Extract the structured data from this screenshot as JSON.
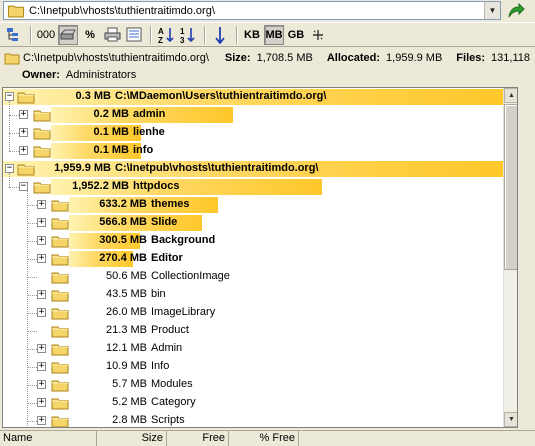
{
  "address": {
    "path": "C:\\Inetpub\\vhosts\\tuthientraitimdo.org\\"
  },
  "toolbar": {
    "kb": "KB",
    "mb": "MB",
    "gb": "GB",
    "dots": "000",
    "percent": "%",
    "sort_az": "A↓Z",
    "sort_num": "1↓3"
  },
  "info": {
    "path": "C:\\Inetpub\\vhosts\\tuthientraitimdo.org\\",
    "size_label": "Size:",
    "size_value": "1,708.5 MB",
    "alloc_label": "Allocated:",
    "alloc_value": "1,959.9 MB",
    "files_label": "Files:",
    "files_value": "131,118",
    "owner_label": "Owner:",
    "owner_value": "Administrators"
  },
  "tree": [
    {
      "size": "0.3 MB",
      "name": "C:\\MDaemon\\Users\\tuthientraitimdo.org\\",
      "bold": true,
      "level": 0,
      "exp": "−",
      "bar_pct": 1.0
    },
    {
      "size": "0.2 MB",
      "name": "admin",
      "bold": true,
      "level": 1,
      "exp": "+",
      "bar_pct": 0.67
    },
    {
      "size": "0.1 MB",
      "name": "lienhe",
      "bold": true,
      "level": 1,
      "exp": "+",
      "bar_pct": 0.33
    },
    {
      "size": "0.1 MB",
      "name": "info",
      "bold": true,
      "level": 1,
      "exp": "+",
      "bar_pct": 0.33
    },
    {
      "size": "1,959.9 MB",
      "name": "C:\\Inetpub\\vhosts\\tuthientraitimdo.org\\",
      "bold": true,
      "level": 0,
      "exp": "−",
      "bar_pct": 1.0
    },
    {
      "size": "1,952.2 MB",
      "name": "httpdocs",
      "bold": true,
      "level": 1,
      "exp": "−",
      "bar_pct": 0.996
    },
    {
      "size": "633.2 MB",
      "name": "themes",
      "bold": true,
      "level": 2,
      "exp": "+",
      "bar_pct": 0.324
    },
    {
      "size": "566.8 MB",
      "name": "Slide",
      "bold": true,
      "level": 2,
      "exp": "+",
      "bar_pct": 0.29
    },
    {
      "size": "300.5 MB",
      "name": "Background",
      "bold": true,
      "level": 2,
      "exp": "+",
      "bar_pct": 0.154
    },
    {
      "size": "270.4 MB",
      "name": "Editor",
      "bold": true,
      "level": 2,
      "exp": "+",
      "bar_pct": 0.139
    },
    {
      "size": "50.6 MB",
      "name": "CollectionImage",
      "bold": false,
      "level": 2,
      "exp": "",
      "bar_pct": 0
    },
    {
      "size": "43.5 MB",
      "name": "bin",
      "bold": false,
      "level": 2,
      "exp": "+",
      "bar_pct": 0
    },
    {
      "size": "26.0 MB",
      "name": "ImageLibrary",
      "bold": false,
      "level": 2,
      "exp": "+",
      "bar_pct": 0
    },
    {
      "size": "21.3 MB",
      "name": "Product",
      "bold": false,
      "level": 2,
      "exp": "",
      "bar_pct": 0
    },
    {
      "size": "12.1 MB",
      "name": "Admin",
      "bold": false,
      "level": 2,
      "exp": "+",
      "bar_pct": 0
    },
    {
      "size": "10.9 MB",
      "name": "Info",
      "bold": false,
      "level": 2,
      "exp": "+",
      "bar_pct": 0
    },
    {
      "size": "5.7 MB",
      "name": "Modules",
      "bold": false,
      "level": 2,
      "exp": "+",
      "bar_pct": 0
    },
    {
      "size": "5.2 MB",
      "name": "Category",
      "bold": false,
      "level": 2,
      "exp": "+",
      "bar_pct": 0
    },
    {
      "size": "2.8 MB",
      "name": "Scripts",
      "bold": false,
      "level": 2,
      "exp": "+",
      "bar_pct": 0
    }
  ],
  "columns": {
    "name": "Name",
    "size": "Size",
    "free": "Free",
    "pct_free": "% Free"
  },
  "colors": {
    "bar_start": "#fff3b0",
    "bar_end": "#ffc82a",
    "folder": "#f5d56a"
  }
}
